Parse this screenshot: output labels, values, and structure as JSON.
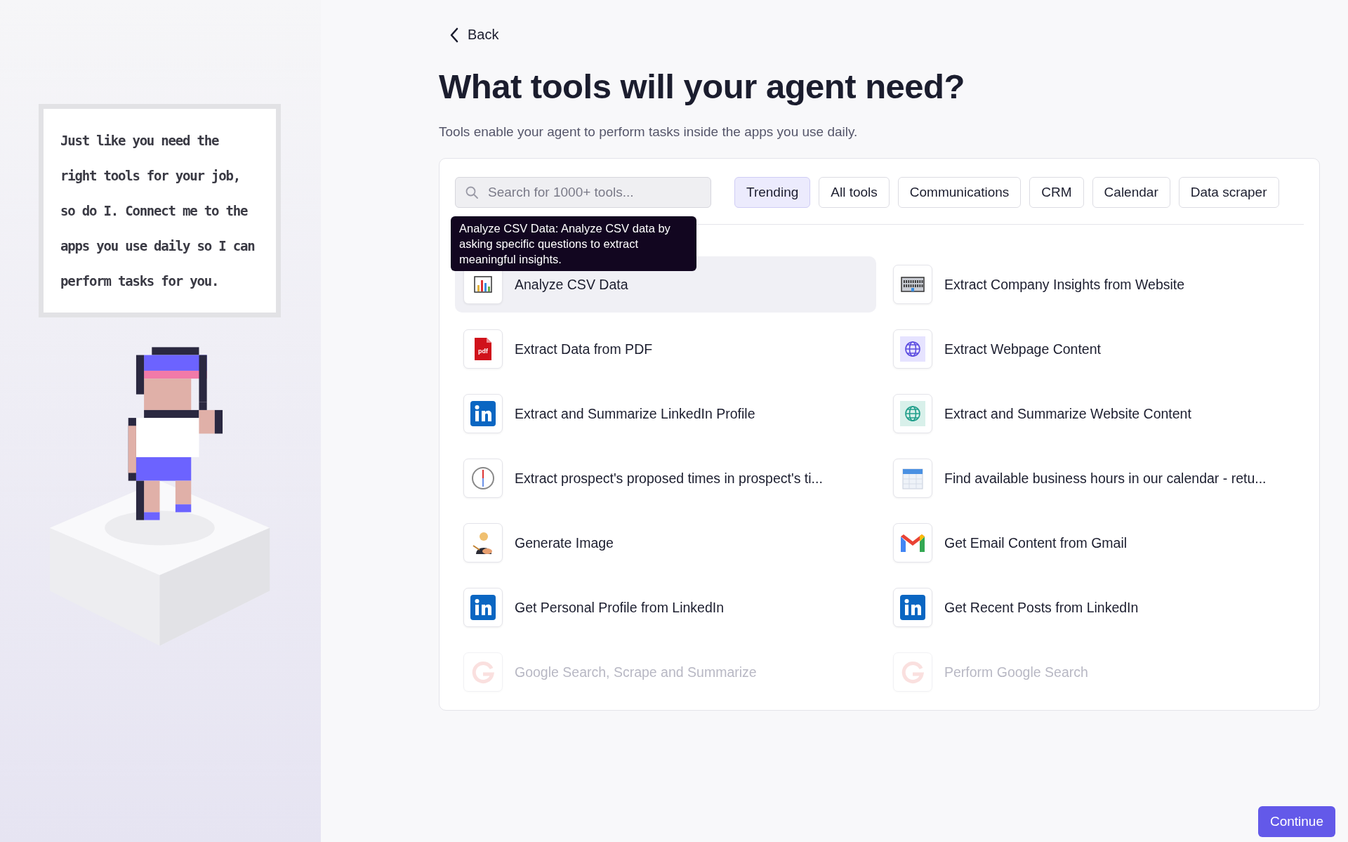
{
  "back": {
    "label": "Back"
  },
  "speech_bubble": {
    "text": "Just like you need the right tools for your job, so do I. Connect me to the apps you use daily so I can perform tasks for you."
  },
  "title": "What tools will your agent need?",
  "subtitle": "Tools enable your agent to perform tasks inside the apps you use daily.",
  "search": {
    "placeholder": "Search for 1000+ tools..."
  },
  "tabs": [
    {
      "label": "Trending",
      "selected": true
    },
    {
      "label": "All tools",
      "selected": false
    },
    {
      "label": "Communications",
      "selected": false
    },
    {
      "label": "CRM",
      "selected": false
    },
    {
      "label": "Calendar",
      "selected": false
    },
    {
      "label": "Data scraper",
      "selected": false
    }
  ],
  "tooltip": "Analyze CSV Data: Analyze CSV data by asking specific questions to extract meaningful insights.",
  "tools": [
    {
      "name": "Analyze CSV Data",
      "kind": "chart",
      "hovered": true,
      "faded": false
    },
    {
      "name": "Extract Company Insights from Website",
      "kind": "building",
      "hovered": false,
      "faded": false
    },
    {
      "name": "Extract Data from PDF",
      "kind": "pdf",
      "hovered": false,
      "faded": false
    },
    {
      "name": "Extract Webpage Content",
      "kind": "globe",
      "hovered": false,
      "faded": false
    },
    {
      "name": "Extract and Summarize LinkedIn Profile",
      "kind": "linkedin",
      "hovered": false,
      "faded": false
    },
    {
      "name": "Extract and Summarize Website Content",
      "kind": "globe-teal",
      "hovered": false,
      "faded": false
    },
    {
      "name": "Extract prospect's proposed times in prospect's ti...",
      "kind": "clock",
      "hovered": false,
      "faded": false
    },
    {
      "name": "Find available business hours in our calendar - retu...",
      "kind": "calendar",
      "hovered": false,
      "faded": false
    },
    {
      "name": "Generate Image",
      "kind": "artist",
      "hovered": false,
      "faded": false
    },
    {
      "name": "Get Email Content from Gmail",
      "kind": "gmail",
      "hovered": false,
      "faded": false
    },
    {
      "name": "Get Personal Profile from LinkedIn",
      "kind": "linkedin",
      "hovered": false,
      "faded": false
    },
    {
      "name": "Get Recent Posts from LinkedIn",
      "kind": "linkedin",
      "hovered": false,
      "faded": false
    },
    {
      "name": "Google Search, Scrape and Summarize",
      "kind": "google",
      "hovered": false,
      "faded": true
    },
    {
      "name": "Perform Google Search",
      "kind": "google",
      "hovered": false,
      "faded": true
    }
  ],
  "continue_button": {
    "label": "Continue"
  }
}
